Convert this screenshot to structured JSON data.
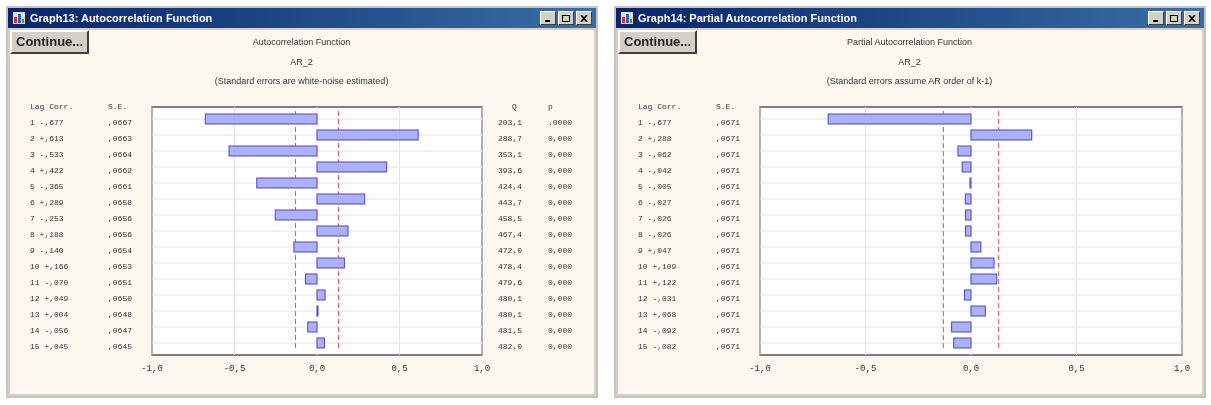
{
  "windows": [
    {
      "title": "Graph13: Autocorrelation Function",
      "button": "Continue...",
      "heading": "Autocorrelation Function",
      "variable": "AR_2",
      "note": "(Standard errors are white-noise estimated)",
      "columns": [
        "Lag Corr.",
        "S.E.",
        "Q",
        "p"
      ],
      "rows": [
        {
          "lag_corr": "1 -,677",
          "se": ",0667",
          "q": "203,1",
          "p": ".0000"
        },
        {
          "lag_corr": "2 +,613",
          "se": ",0663",
          "q": "288,7",
          "p": "0,000"
        },
        {
          "lag_corr": "3 -,533",
          "se": ",0664",
          "q": "353,1",
          "p": "0,000"
        },
        {
          "lag_corr": "4 +,422",
          "se": ",0662",
          "q": "393,6",
          "p": "0,000"
        },
        {
          "lag_corr": "5 -,365",
          "se": ",0661",
          "q": "424,4",
          "p": "0,000"
        },
        {
          "lag_corr": "6 +,289",
          "se": ",0658",
          "q": "443,7",
          "p": "0,000"
        },
        {
          "lag_corr": "7 -,253",
          "se": ",0656",
          "q": "458,5",
          "p": "0,000"
        },
        {
          "lag_corr": "8 +,188",
          "se": ",0656",
          "q": "467,4",
          "p": "0,000"
        },
        {
          "lag_corr": "9 -,140",
          "se": ",0654",
          "q": "472,0",
          "p": "0,000"
        },
        {
          "lag_corr": "10 +,166",
          "se": ",0653",
          "q": "478,4",
          "p": "0,000"
        },
        {
          "lag_corr": "11 -,070",
          "se": ",0651",
          "q": "479,6",
          "p": "0,000"
        },
        {
          "lag_corr": "12 +,049",
          "se": ",0650",
          "q": "480,1",
          "p": "0,000"
        },
        {
          "lag_corr": "13 +,004",
          "se": ",0648",
          "q": "480,1",
          "p": "0,000"
        },
        {
          "lag_corr": "14 -,056",
          "se": ",0647",
          "q": "481,5",
          "p": "0,000"
        },
        {
          "lag_corr": "15 +,045",
          "se": ",0645",
          "q": "482,0",
          "p": "0,000"
        }
      ],
      "chart_data": {
        "type": "bar",
        "orientation": "horizontal",
        "values": [
          -0.677,
          0.613,
          -0.533,
          0.422,
          -0.365,
          0.289,
          -0.253,
          0.188,
          -0.14,
          0.166,
          -0.07,
          0.049,
          0.004,
          -0.056,
          0.045
        ],
        "xlim": [
          -1,
          1
        ],
        "xticks": [
          {
            "value": -1,
            "label": "-1,0"
          },
          {
            "value": -0.5,
            "label": "-0,5"
          },
          {
            "value": 0,
            "label": "0,0"
          },
          {
            "value": 0.5,
            "label": "0,5"
          },
          {
            "value": 1,
            "label": "1,0"
          }
        ],
        "grid": true,
        "ref_lines": [
          {
            "axis": "x",
            "value": -0.13
          },
          {
            "axis": "x",
            "value": 0.13
          }
        ]
      }
    },
    {
      "title": "Graph14: Partial Autocorrelation Function",
      "button": "Continue...",
      "heading": "Partial Autocorrelation Function",
      "variable": "AR_2",
      "note": "(Standard errors assume AR order of k-1)",
      "columns": [
        "Lag Corr.",
        "S.E."
      ],
      "rows": [
        {
          "lag_corr": "1 -,677",
          "se": ",0671"
        },
        {
          "lag_corr": "2 +,288",
          "se": ",0671"
        },
        {
          "lag_corr": "3 -,062",
          "se": ",0671"
        },
        {
          "lag_corr": "4 -,042",
          "se": ",0671"
        },
        {
          "lag_corr": "5 -,005",
          "se": ",0671"
        },
        {
          "lag_corr": "6 -,027",
          "se": ",0671"
        },
        {
          "lag_corr": "7 -,026",
          "se": ",0671"
        },
        {
          "lag_corr": "8 -,026",
          "se": ",0671"
        },
        {
          "lag_corr": "9 +,047",
          "se": ",0671"
        },
        {
          "lag_corr": "10 +,109",
          "se": ",0671"
        },
        {
          "lag_corr": "11 +,122",
          "se": ",0671"
        },
        {
          "lag_corr": "12 -,031",
          "se": ",0671"
        },
        {
          "lag_corr": "13 +,068",
          "se": ",0671"
        },
        {
          "lag_corr": "14 -,092",
          "se": ",0671"
        },
        {
          "lag_corr": "15 -,082",
          "se": ",0671"
        }
      ],
      "chart_data": {
        "type": "bar",
        "orientation": "horizontal",
        "values": [
          -0.677,
          0.288,
          -0.062,
          -0.042,
          -0.005,
          -0.027,
          -0.026,
          -0.026,
          0.047,
          0.109,
          0.122,
          -0.031,
          0.068,
          -0.092,
          -0.082
        ],
        "xlim": [
          -1,
          1
        ],
        "xticks": [
          {
            "value": -1,
            "label": "-1,0"
          },
          {
            "value": -0.5,
            "label": "-0,5"
          },
          {
            "value": 0,
            "label": "0,0"
          },
          {
            "value": 0.5,
            "label": "0,5"
          },
          {
            "value": 1,
            "label": "1,0"
          }
        ],
        "grid": true,
        "ref_lines": [
          {
            "axis": "x",
            "value": -0.131
          },
          {
            "axis": "x",
            "value": 0.131
          }
        ]
      }
    }
  ]
}
